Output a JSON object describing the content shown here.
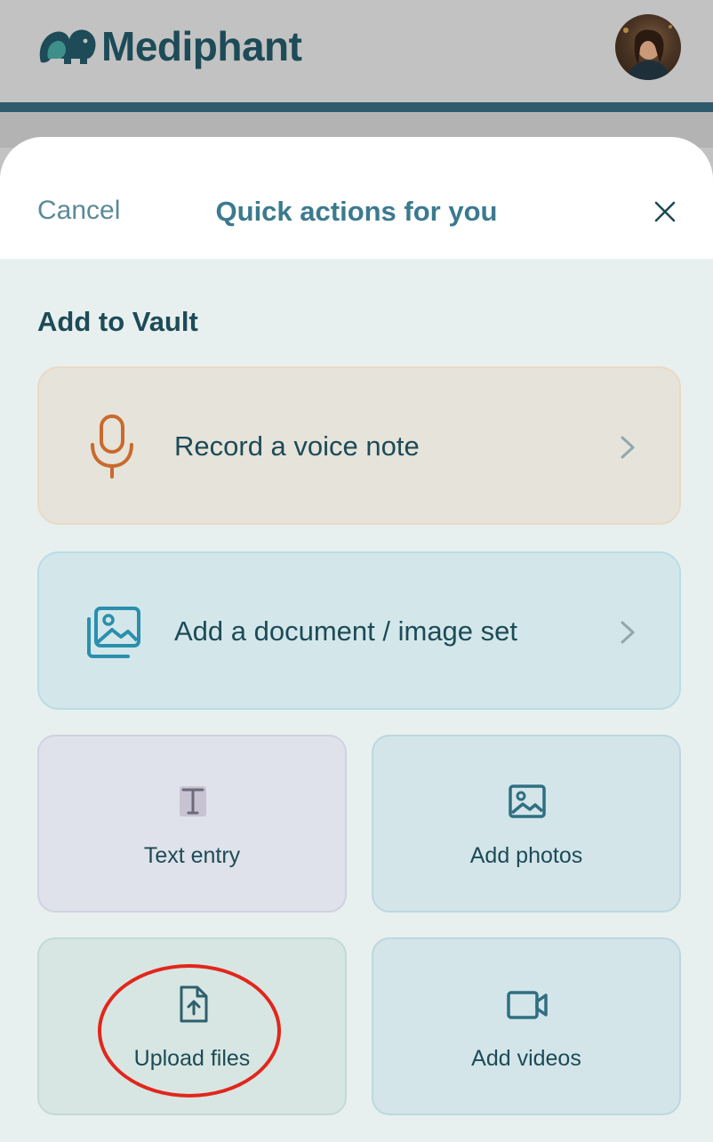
{
  "header": {
    "app_name": "Mediphant",
    "logo_icon": "elephant-logo-icon",
    "avatar_icon": "user-avatar"
  },
  "sheet": {
    "cancel_label": "Cancel",
    "title": "Quick actions for you",
    "close_icon": "close-icon"
  },
  "vault": {
    "section_title": "Add to Vault",
    "actions": [
      {
        "label": "Record a voice note",
        "icon": "microphone-icon"
      },
      {
        "label": "Add a document / image set",
        "icon": "image-stack-icon"
      }
    ],
    "tiles": [
      {
        "label": "Text entry",
        "icon": "text-icon"
      },
      {
        "label": "Add photos",
        "icon": "photo-icon"
      },
      {
        "label": "Upload files",
        "icon": "file-upload-icon"
      },
      {
        "label": "Add videos",
        "icon": "video-camera-icon"
      }
    ]
  },
  "colors": {
    "brand": "#1d4b57",
    "accent": "#3b7a8e",
    "voice_accent": "#c96a2c",
    "highlight": "#e2261c"
  }
}
